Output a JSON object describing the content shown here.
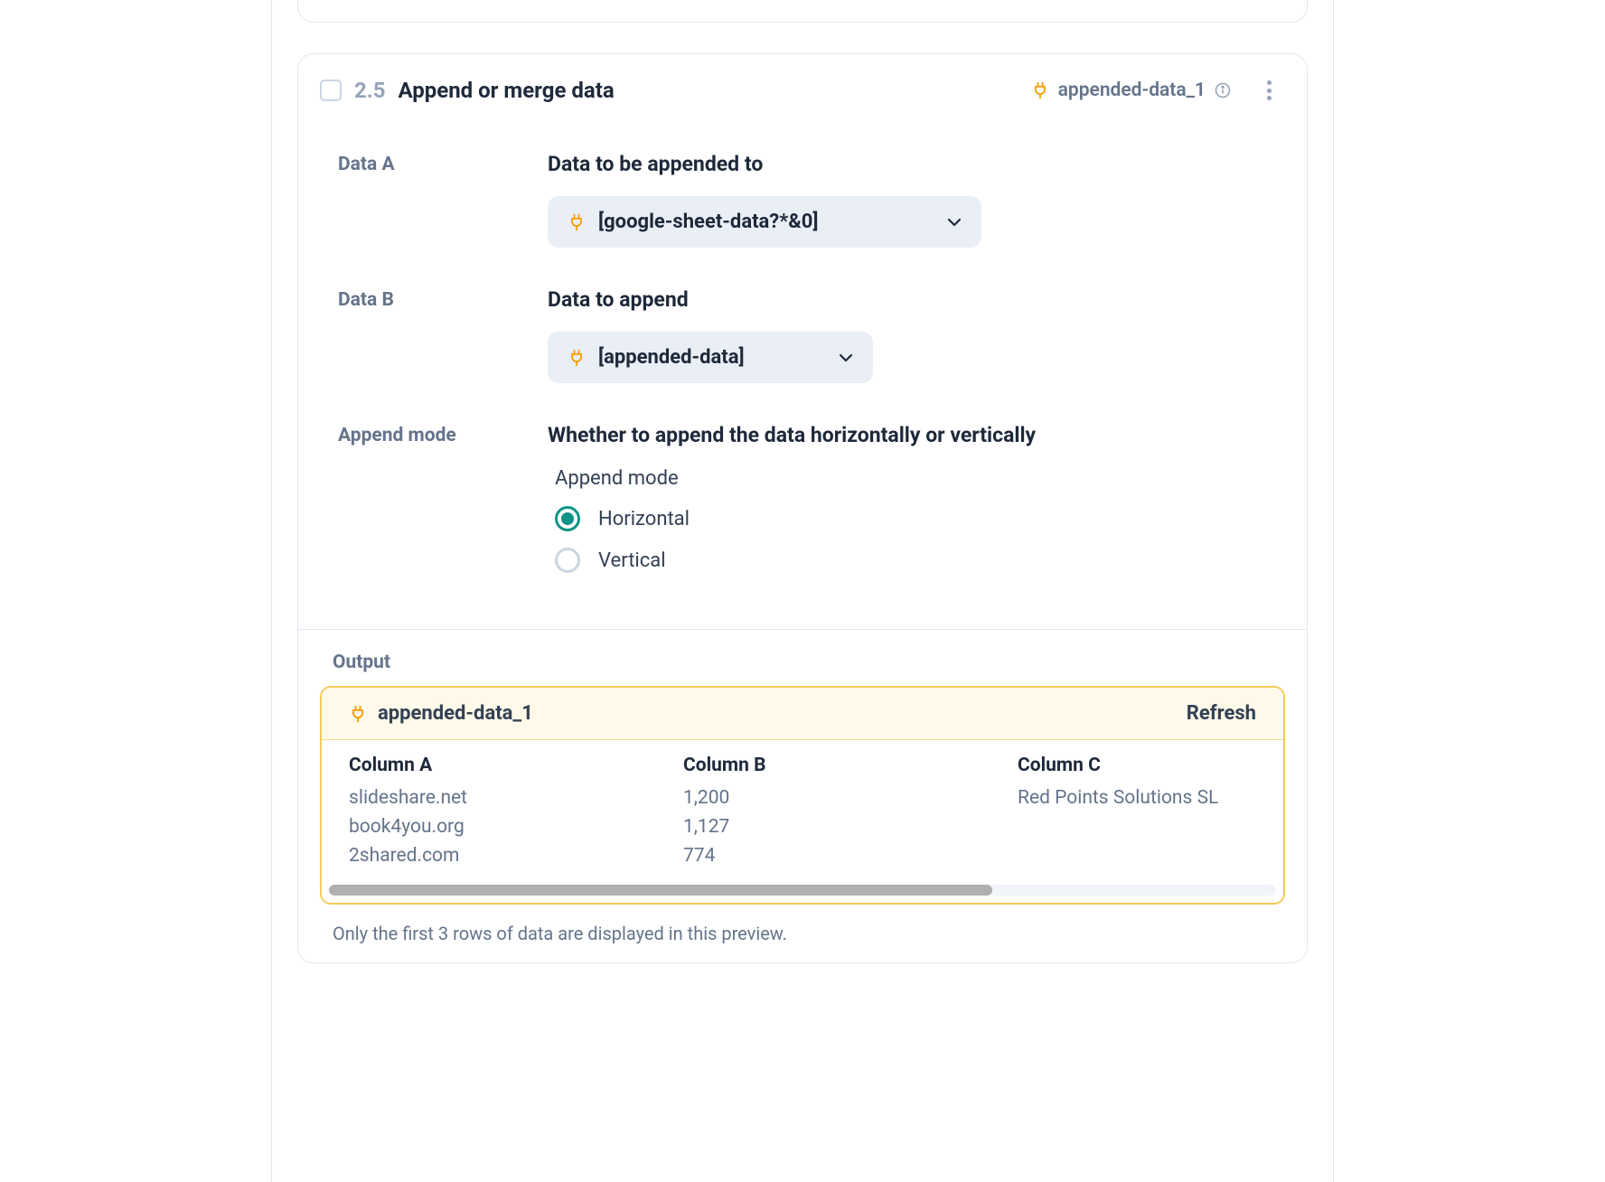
{
  "step": {
    "number": "2.5",
    "title": "Append or merge data",
    "output_name": "appended-data_1"
  },
  "fields": {
    "data_a": {
      "label": "Data A",
      "title": "Data to be appended to",
      "value": "[google-sheet-data?*&0]"
    },
    "data_b": {
      "label": "Data B",
      "title": "Data to append",
      "value": "[appended-data]"
    },
    "append_mode": {
      "label": "Append mode",
      "title": "Whether to append the data horizontally or vertically",
      "group_label": "Append mode",
      "options": {
        "horizontal": "Horizontal",
        "vertical": "Vertical"
      },
      "selected": "horizontal"
    }
  },
  "output": {
    "heading": "Output",
    "name": "appended-data_1",
    "refresh": "Refresh",
    "columns": [
      "Column A",
      "Column B",
      "Column C"
    ],
    "rows": [
      [
        "slideshare.net",
        "1,200",
        "Red Points Solutions SL"
      ],
      [
        "book4you.org",
        "1,127",
        ""
      ],
      [
        "2shared.com",
        "774",
        ""
      ]
    ],
    "scrollbar_percent": 70,
    "note": "Only the first 3 rows of data are displayed in this preview."
  },
  "colors": {
    "accent_orange": "#f59e0b",
    "accent_teal": "#0d9488",
    "output_border": "#f2cc5b",
    "output_bg": "#fef9e8"
  }
}
